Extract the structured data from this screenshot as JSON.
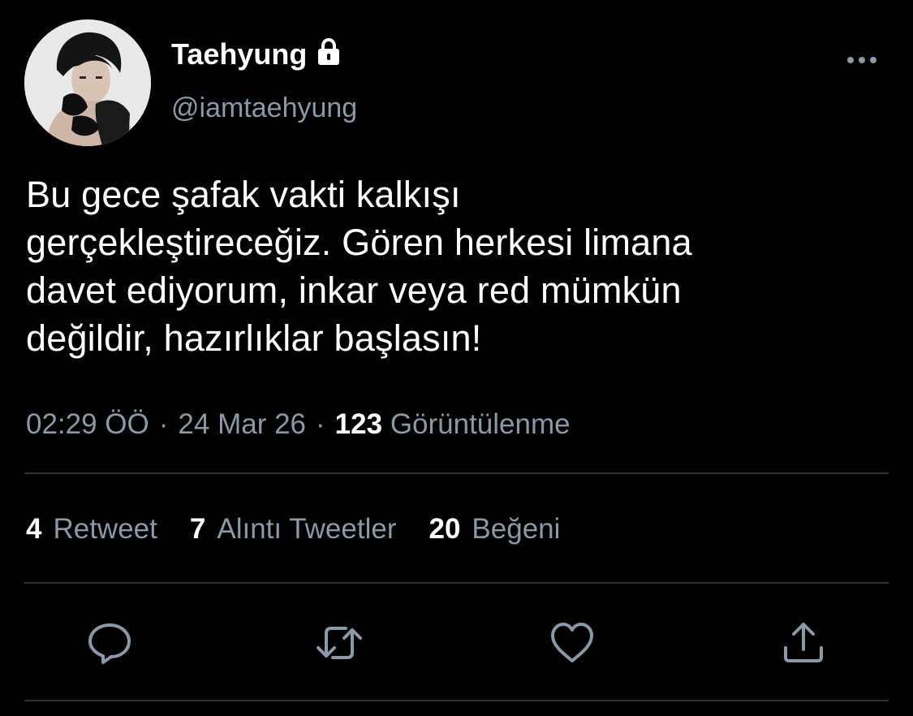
{
  "user": {
    "display_name": "Taehyung",
    "handle": "@iamtaehyung",
    "protected_icon": "lock-icon",
    "avatar": "profile-photo"
  },
  "header": {
    "more_icon": "more-horizontal-icon"
  },
  "tweet": {
    "lines": [
      "Bu gece şafak vakti kalkışı",
      "gerçekleştireceğiz. Gören herkesi limana",
      "davet ediyorum, inkar veya red mümkün",
      "değildir, hazırlıklar başlasın!"
    ]
  },
  "meta": {
    "time": "02:29 ÖÖ",
    "separator": "·",
    "date": "24 Mar 26",
    "views_count": "123",
    "views_label": "Görüntülenme"
  },
  "stats": [
    {
      "count": "4",
      "label": "Retweet"
    },
    {
      "count": "7",
      "label": "Alıntı Tweetler"
    },
    {
      "count": "20",
      "label": "Beğeni"
    }
  ],
  "actions": [
    {
      "name": "reply",
      "icon": "reply-icon"
    },
    {
      "name": "retweet",
      "icon": "retweet-icon"
    },
    {
      "name": "like",
      "icon": "heart-icon"
    },
    {
      "name": "share",
      "icon": "share-icon"
    }
  ],
  "colors": {
    "background": "#000000",
    "primary_text": "#ffffff",
    "secondary_text": "#8b98a5",
    "divider": "#2f3336",
    "icon": "#8b98a5"
  }
}
